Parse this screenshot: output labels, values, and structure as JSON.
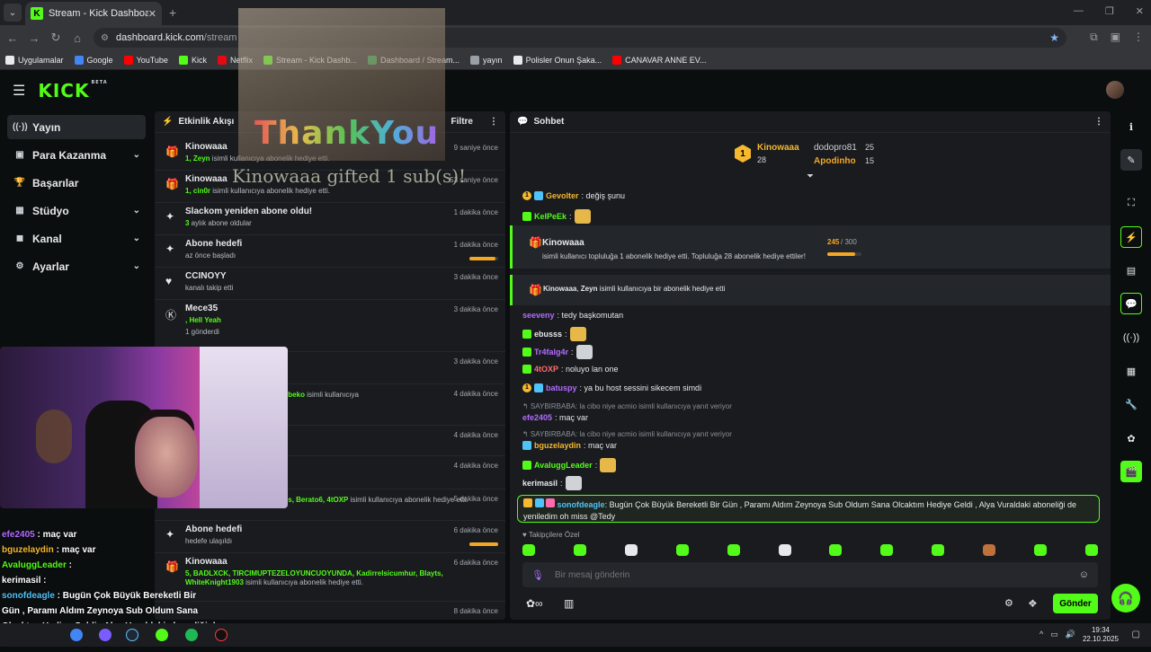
{
  "browser": {
    "tab_title": "Stream - Kick Dashboard",
    "url_host": "dashboard.kick.com",
    "url_path": "/stream",
    "bookmarks": [
      {
        "label": "Uygulamalar",
        "color": "#e8eaed"
      },
      {
        "label": "Google",
        "color": "#4285f4"
      },
      {
        "label": "YouTube",
        "color": "#ff0000"
      },
      {
        "label": "Kick",
        "color": "#53fc18"
      },
      {
        "label": "Netflix",
        "color": "#e50914"
      },
      {
        "label": "Stream - Kick Dashb...",
        "color": "#53fc18"
      },
      {
        "label": "Dashboard / Stream...",
        "color": "#34a853"
      },
      {
        "label": "yayın",
        "color": "#9aa0a6"
      },
      {
        "label": "Polisler Onun Şaka...",
        "color": "#e8eaed"
      },
      {
        "label": "CANAVAR ANNE EV...",
        "color": "#ff0000"
      }
    ]
  },
  "header": {
    "logo": "KICK",
    "beta": "BETA"
  },
  "sidebar": {
    "items": [
      {
        "label": "Yayın",
        "icon": "broadcast-icon",
        "glyph": "((·))",
        "chevron": false,
        "active": true
      },
      {
        "label": "Para Kazanma",
        "icon": "money-icon",
        "glyph": "▣",
        "chevron": true,
        "active": false
      },
      {
        "label": "Başarılar",
        "icon": "trophy-icon",
        "glyph": "🏆",
        "chevron": false,
        "active": false
      },
      {
        "label": "Stüdyo",
        "icon": "studio-icon",
        "glyph": "▦",
        "chevron": true,
        "active": false
      },
      {
        "label": "Kanal",
        "icon": "channel-icon",
        "glyph": "◼",
        "chevron": true,
        "active": false
      },
      {
        "label": "Ayarlar",
        "icon": "settings-icon",
        "glyph": "⚙",
        "chevron": true,
        "active": false
      }
    ]
  },
  "events": {
    "title": "Etkinlik Akışı",
    "filter_label": "Filtre",
    "items": [
      {
        "name": "Kinowaaa",
        "line1_green": "1, Zeyn",
        "line1": " isimli kullanıcıya abonelik hediye etti.",
        "line2": "",
        "time": "9 saniye önce",
        "icon": "gift-icon",
        "glyph": "🎁",
        "progress": null
      },
      {
        "name": "Kinowaaa",
        "line1_green": "1, cin0r",
        "line1": " isimli kullanıcıya abonelik hediye etti.",
        "line2": "",
        "time": "53 saniye önce",
        "icon": "gift-icon",
        "glyph": "🎁",
        "progress": null
      },
      {
        "name": "Slackom yeniden abone oldu!",
        "line1_green": "3",
        "line1": " aylık abone oldular",
        "line2": "",
        "time": "1 dakika önce",
        "icon": "sparkle-icon",
        "glyph": "✦",
        "progress": null
      },
      {
        "name": "Abone hedefi",
        "line1_green": "",
        "line1": "az önce başladı",
        "line2": "",
        "time": "1 dakika önce",
        "icon": "sparkle-icon",
        "glyph": "✦",
        "progress": 0.9
      },
      {
        "name": "CCINOYY",
        "line1_green": "",
        "line1": "kanalı takip etti",
        "line2": "",
        "time": "3 dakika önce",
        "icon": "heart-icon",
        "glyph": "♥",
        "progress": null
      },
      {
        "name": "Mece35",
        "line1_green": ", Hell Yeah",
        "line1": "",
        "line2": "1 gönderdi",
        "time": "3 dakika önce",
        "icon": "kick-coin-icon",
        "glyph": "Ⓚ",
        "progress": null
      },
      {
        "name": "",
        "line1_green": "",
        "line1": "",
        "line2": "",
        "time": "3 dakika önce",
        "icon": "gift-icon",
        "glyph": "",
        "progress": null
      },
      {
        "name": "",
        "line1_green": "i, kemal_bey58, 0rexa0, netluxbeko",
        "line1": " isimli kullanıcıya",
        "line2": "",
        "time": "4 dakika önce",
        "icon": "gift-icon",
        "glyph": "",
        "progress": null
      },
      {
        "name": "",
        "line1_green": "",
        "line1": "",
        "line2": "",
        "time": "4 dakika önce",
        "icon": "gift-icon",
        "glyph": "",
        "progress": null
      },
      {
        "name": "",
        "line1_green": "",
        "line1": "",
        "line2": "",
        "time": "4 dakika önce",
        "icon": "gift-icon",
        "glyph": "",
        "progress": null
      },
      {
        "name": "",
        "line1_green": "5, KelN_K, TomiokaHyp, Lyncis, Berato6, 4tOXP",
        "line1": " isimli kullanıcıya abonelik hediye etti.",
        "line2": "",
        "time": "5 dakika önce",
        "icon": "gift-icon",
        "glyph": "",
        "progress": null
      },
      {
        "name": "Abone hedefi",
        "line1_green": "",
        "line1": "hedefe ulaşıldı",
        "line2": "",
        "time": "6 dakika önce",
        "icon": "sparkle-icon",
        "glyph": "✦",
        "progress": 1.0
      },
      {
        "name": "Kinowaaa",
        "line1_green": "5, BADLXCK, TIRCIMUPTEZELOYUNCUOYUNDA, Kadirrelsicumhur, Blayts, WhiteKnight1903",
        "line1": " isimli kullanıcıya abonelik hediye etti.",
        "line2": "",
        "time": "6 dakika önce",
        "icon": "gift-icon",
        "glyph": "🎁",
        "progress": null
      },
      {
        "name": "",
        "line1_green": "",
        "line1": "",
        "line2": "",
        "time": "8 dakika önce",
        "icon": "gift-icon",
        "glyph": "",
        "progress": null
      }
    ]
  },
  "chat": {
    "title": "Sohbet",
    "top_gifters": {
      "first": {
        "rank": "1",
        "name": "Kinowaaa",
        "count": "28"
      },
      "second": {
        "name": "dodopro81",
        "count": "25"
      },
      "third": {
        "name": "Apodinho",
        "count": "15"
      }
    },
    "messages": [
      {
        "user": "Gevolter",
        "color": "#f5b82e",
        "text": ": değiş şunu",
        "badges": [
          "gold",
          "blue"
        ],
        "emote": false
      },
      {
        "user": "KelPeEk",
        "color": "#53fc18",
        "text": ":",
        "badges": [
          "sub"
        ],
        "emote": true
      }
    ],
    "pinned1": {
      "user": "Kinowaaa",
      "text": "isimli kullanıcı topluluğa 1 abonelik hediye etti. Topluluğa 28 abonelik hediye ettiler!",
      "goal": "245",
      "goal_total": " / 300",
      "progress": 0.82
    },
    "pinned2": {
      "user": "Kinowaaa",
      "user2": "Zeyn",
      "text": " isimli kullanıcıya bir abonelik hediye etti"
    },
    "messages2": [
      {
        "user": "seeveny",
        "color": "#b26bff",
        "text": ": tedy başkomutan",
        "badges": [],
        "emote": false
      },
      {
        "user": "ebusss",
        "color": "#e6e8ea",
        "text": ":",
        "badges": [
          "sub"
        ],
        "emote": true
      },
      {
        "user": "Tr4falg4r",
        "color": "#b26bff",
        "text": ":",
        "badges": [
          "sub"
        ],
        "emote": true
      },
      {
        "user": "4tOXP",
        "color": "#ff6b6b",
        "text": ": noluyo lan one",
        "badges": [
          "sub"
        ],
        "emote": false
      },
      {
        "user": "batuspy",
        "color": "#b26bff",
        "text": ": ya bu host sessini sikecem simdi",
        "badges": [
          "gold",
          "blue"
        ],
        "emote": false
      }
    ],
    "reply1": "↰ SAYBIRBABA: la cibo niye acmio isimli kullanıcıya yanıt veriyor",
    "msg_efe": {
      "user": "efe2405",
      "color": "#b26bff",
      "text": ": maç var"
    },
    "reply2": "↰ SAYBIRBABA: la cibo niye acmio isimli kullanıcıya yanıt veriyor",
    "messages3": [
      {
        "user": "bguzelaydin",
        "color": "#f5b82e",
        "text": ": maç var",
        "badges": [
          "blue"
        ],
        "emote": false
      },
      {
        "user": "AvaluggLeader",
        "color": "#53fc18",
        "text": ":",
        "badges": [
          "sub"
        ],
        "emote": true
      },
      {
        "user": "kerimasil",
        "color": "#e6e8ea",
        "text": ":",
        "badges": [],
        "emote": true
      }
    ],
    "highlight": {
      "user": "sonofdeagle",
      "text": ": Bugün Çok Büyük Bereketli Bir Gün , Paramı Aldım Zeynoya Sub Oldum Sana Olcaktım Hediye Geldi , Alya Vuraldaki aboneliği de yeniledim oh miss @Tedy"
    },
    "followers_only": "♥ Takipçilere Özel",
    "input_placeholder": "Bir mesaj gönderin",
    "send_label": "Gönder"
  },
  "overlay": {
    "thankyou": "ThankYou",
    "gifted": "Kinowaaa gifted 1 sub(s)!",
    "chat_lines": [
      {
        "user": "efe2405",
        "text": " : maç var",
        "color": "#b26bff"
      },
      {
        "user": "bguzelaydin",
        "text": " : maç var",
        "color": "#f5b82e"
      },
      {
        "user": "AvaluggLeader",
        "text": " : ",
        "color": "#53fc18"
      },
      {
        "user": "kerimasil",
        "text": " : ",
        "color": "#ffffff"
      },
      {
        "user": "sonofdeagle",
        "text": " : Bugün Çok Büyük Bereketli Bir",
        "color": "#4fc3f7"
      },
      {
        "user": "",
        "text": "Gün , Paramı Aldım Zeynoya Sub Oldum Sana",
        "color": "#ffffff"
      },
      {
        "user": "",
        "text": "Olcaktım Hediye Geldi , Alya Vuraldaki aboneliği de",
        "color": "#ffffff"
      },
      {
        "user": "",
        "text": "yeniledim oh miss @Tedy",
        "color": "#ffffff"
      }
    ]
  },
  "taskbar": {
    "time": "19:34",
    "date": "22.10.2025"
  },
  "colors": {
    "accent": "#53fc18",
    "panel": "#191b1f",
    "bg": "#0b0e0f"
  }
}
